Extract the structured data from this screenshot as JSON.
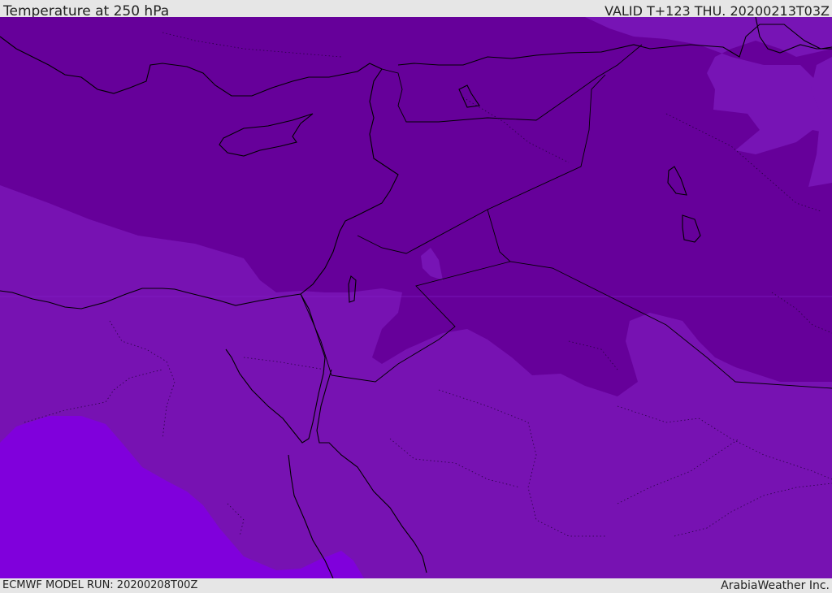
{
  "header": {
    "title": "Temperature at 250 hPa",
    "valid": "VALID T+123 THU. 20200213T03Z"
  },
  "footer": {
    "model_run": "ECMWF MODEL RUN: 20200208T00Z",
    "brand": "ArabiaWeather Inc."
  },
  "map": {
    "region": "Eastern Mediterranean and Middle East",
    "field": "Temperature at 250 hPa",
    "colors": {
      "cold_band": "#650099",
      "mid_band": "#7710b0",
      "warm_band": "#7f00da",
      "pale_patch": "#7a18bf",
      "coastline": "#000000"
    }
  }
}
